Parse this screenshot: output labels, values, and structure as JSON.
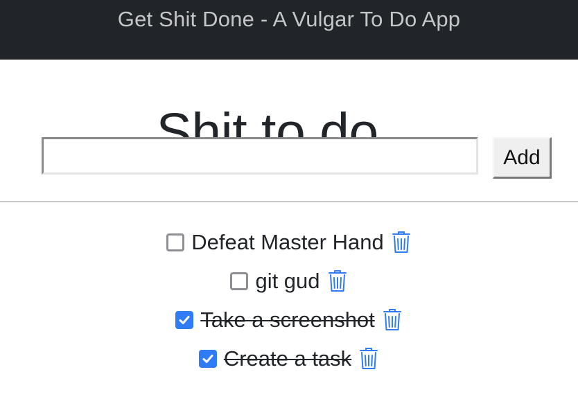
{
  "header": {
    "app_title": "Get Shit Done - A Vulgar To Do App"
  },
  "main": {
    "page_title": "Shit to do...",
    "new_task_input": {
      "value": "",
      "placeholder": ""
    },
    "add_button_label": "Add"
  },
  "tasks": [
    {
      "text": "Defeat Master Hand",
      "completed": false
    },
    {
      "text": "git gud",
      "completed": false
    },
    {
      "text": "Take a screenshot",
      "completed": true
    },
    {
      "text": "Create a task",
      "completed": true
    }
  ],
  "icons": {
    "checkbox": "checkbox-icon",
    "checkmark": "checkmark-icon",
    "delete": "trash-icon"
  },
  "colors": {
    "header_background": "#212529",
    "header_text": "#c4c6c8",
    "accent": "#2f7cf6",
    "text": "#212529"
  }
}
